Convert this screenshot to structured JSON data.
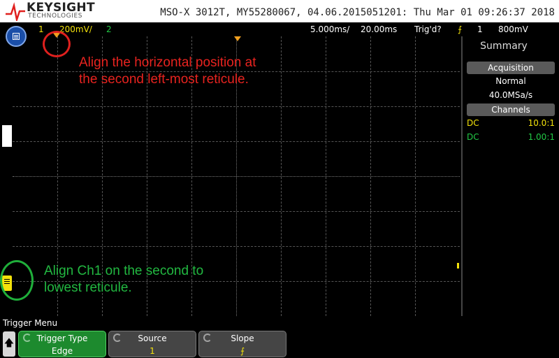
{
  "header": {
    "brand": "KEYSIGHT",
    "brand_sub": "TECHNOLOGIES",
    "instrument_info": "MSO-X 3012T, MY55280067, 04.06.2015051201: Thu Mar 01 09:26:37 2018"
  },
  "status": {
    "ch1_number": "1",
    "ch1_scale": "200mV/",
    "ch2_number": "2",
    "time_scale": "5.000ms/",
    "time_delay": "20.00ms",
    "trigger_state": "Trig'd?",
    "trigger_slope_icon": "rising-edge-icon",
    "trigger_source": "1",
    "trigger_level": "800mV"
  },
  "annotations": {
    "red_line1": "Align the horizontal position at",
    "red_line2": "the second left-most reticule.",
    "green_line1": "Align Ch1 on the second to",
    "green_line2": "lowest reticule."
  },
  "panel": {
    "title": "Summary",
    "acquisition_header": "Acquisition",
    "acquisition_mode": "Normal",
    "sample_rate": "40.0MSa/s",
    "channels_header": "Channels",
    "channels": [
      {
        "coupling": "DC",
        "probe": "10.0:1",
        "color": "#f3e20b"
      },
      {
        "coupling": "DC",
        "probe": "1.00:1",
        "color": "#22c945"
      }
    ]
  },
  "menu": {
    "title": "Trigger Menu",
    "up_icon": "up-arrow-icon",
    "softkeys": [
      {
        "label": "Trigger Type",
        "value": "Edge"
      },
      {
        "label": "Source",
        "value": "1"
      },
      {
        "label": "Slope",
        "value": "⨍"
      }
    ]
  },
  "colors": {
    "ch1": "#f3e20b",
    "ch2": "#22c945",
    "trigger": "#f0a020",
    "annotation_red": "#e8231f",
    "annotation_green": "#22b841",
    "menu_blue": "#1a4ea8"
  }
}
